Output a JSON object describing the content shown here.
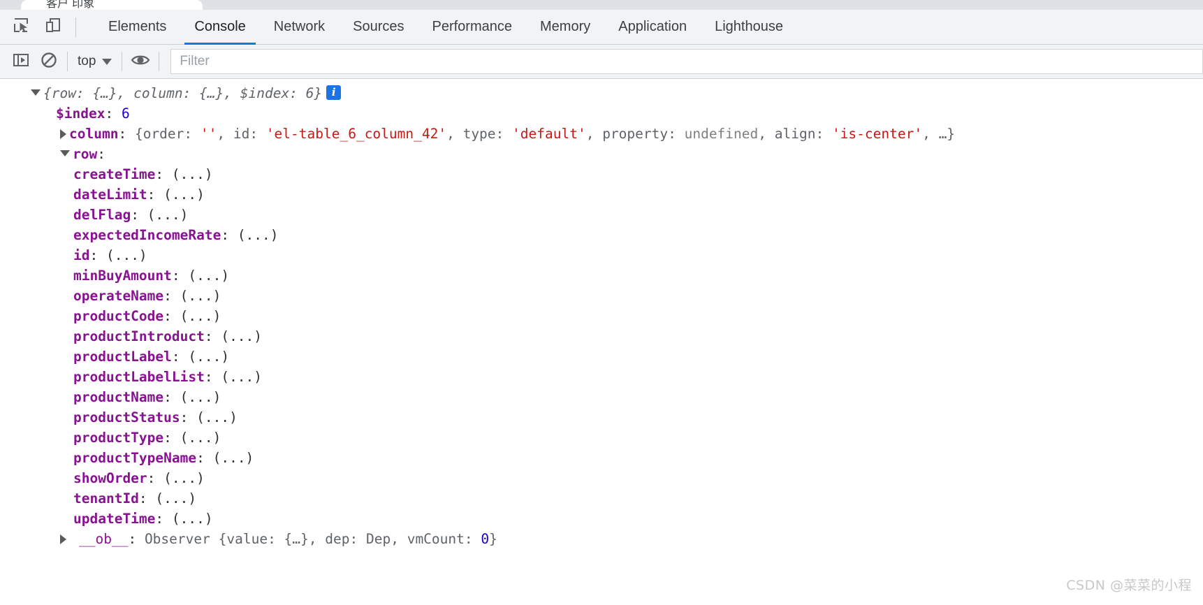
{
  "browser_tab": {
    "title": "客户 印象"
  },
  "toolbar": {
    "inspect_icon": "inspect-element-icon",
    "device_icon": "device-toolbar-icon"
  },
  "tabs": [
    {
      "label": "Elements",
      "selected": false
    },
    {
      "label": "Console",
      "selected": true
    },
    {
      "label": "Network",
      "selected": false
    },
    {
      "label": "Sources",
      "selected": false
    },
    {
      "label": "Performance",
      "selected": false
    },
    {
      "label": "Memory",
      "selected": false
    },
    {
      "label": "Application",
      "selected": false
    },
    {
      "label": "Lighthouse",
      "selected": false
    }
  ],
  "filterbar": {
    "sidebar_icon": "console-sidebar-icon",
    "clear_icon": "clear-console-icon",
    "context_label": "top",
    "eye_icon": "live-expression-eye-icon",
    "filter_placeholder": "Filter",
    "filter_value": ""
  },
  "console": {
    "root": {
      "preview": "{row: {…}, column: {…}, $index: 6}",
      "info_badge": "i",
      "expanded": true
    },
    "index_entry": {
      "name": "$index",
      "sep": ": ",
      "value": "6"
    },
    "column_entry": {
      "name": "column",
      "sep": ": ",
      "open_brace": "{",
      "parts": [
        {
          "key": "order",
          "sep": ": ",
          "value": "''",
          "kind": "string",
          "comma": ", "
        },
        {
          "key": "id",
          "sep": ": ",
          "value": "'el-table_6_column_42'",
          "kind": "string",
          "comma": ", "
        },
        {
          "key": "type",
          "sep": ": ",
          "value": "'default'",
          "kind": "string",
          "comma": ", "
        },
        {
          "key": "property",
          "sep": ": ",
          "value": "undefined",
          "kind": "undefined",
          "comma": ", "
        },
        {
          "key": "align",
          "sep": ": ",
          "value": "'is-center'",
          "kind": "string",
          "comma": ", "
        }
      ],
      "tail": "…}",
      "expanded": false
    },
    "row_entry": {
      "name": "row",
      "sep": ":",
      "expanded": true
    },
    "row_properties": [
      {
        "name": "createTime",
        "value": "(...)"
      },
      {
        "name": "dateLimit",
        "value": "(...)"
      },
      {
        "name": "delFlag",
        "value": "(...)"
      },
      {
        "name": "expectedIncomeRate",
        "value": "(...)"
      },
      {
        "name": "id",
        "value": "(...)"
      },
      {
        "name": "minBuyAmount",
        "value": "(...)"
      },
      {
        "name": "operateName",
        "value": "(...)"
      },
      {
        "name": "productCode",
        "value": "(...)"
      },
      {
        "name": "productIntroduct",
        "value": "(...)"
      },
      {
        "name": "productLabel",
        "value": "(...)"
      },
      {
        "name": "productLabelList",
        "value": "(...)"
      },
      {
        "name": "productName",
        "value": "(...)"
      },
      {
        "name": "productStatus",
        "value": "(...)"
      },
      {
        "name": "productType",
        "value": "(...)"
      },
      {
        "name": "productTypeName",
        "value": "(...)"
      },
      {
        "name": "showOrder",
        "value": "(...)"
      },
      {
        "name": "tenantId",
        "value": "(...)"
      },
      {
        "name": "updateTime",
        "value": "(...)"
      }
    ],
    "observer_entry": {
      "name": "__ob__",
      "sep": ": ",
      "class_name": "Observer",
      "body_open": "{",
      "parts": [
        {
          "key": "value",
          "sep": ": ",
          "value": "{…}",
          "kind": "plain",
          "comma": ", "
        },
        {
          "key": "dep",
          "sep": ": ",
          "value": "Dep",
          "kind": "plain",
          "comma": ", "
        },
        {
          "key": "vmCount",
          "sep": ": ",
          "value": "0",
          "kind": "number",
          "comma": ""
        }
      ],
      "body_close": "}",
      "expanded": false
    }
  },
  "watermark": "CSDN @菜菜的小程",
  "colors": {
    "accent": "#1a73e8",
    "property": "#881391",
    "string": "#c41a16",
    "number": "#1c00cf",
    "undefined": "#808080",
    "toolbar_bg": "#f1f3f4"
  }
}
